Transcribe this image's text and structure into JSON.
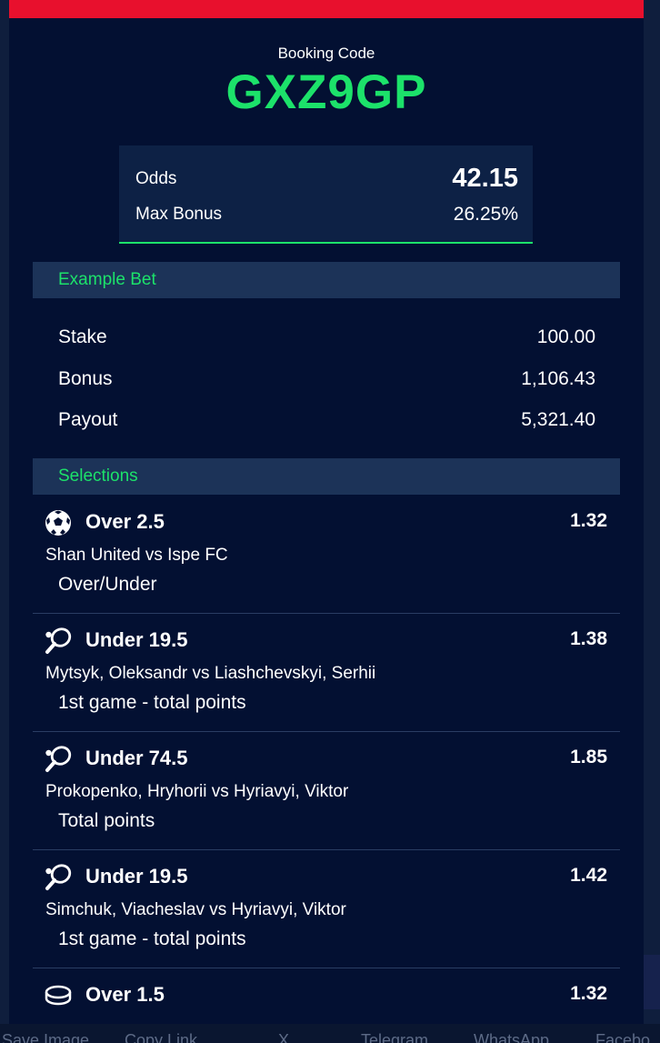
{
  "booking": {
    "label": "Booking Code",
    "code": "GXZ9GP"
  },
  "summary": {
    "odds_label": "Odds",
    "odds_value": "42.15",
    "max_bonus_label": "Max Bonus",
    "max_bonus_value": "26.25%"
  },
  "example_bet": {
    "header": "Example Bet",
    "stake_label": "Stake",
    "stake_value": "100.00",
    "bonus_label": "Bonus",
    "bonus_value": "1,106.43",
    "payout_label": "Payout",
    "payout_value": "5,321.40"
  },
  "selections": {
    "header": "Selections",
    "items": [
      {
        "icon": "soccer-ball-icon",
        "pick": "Over 2.5",
        "odds": "1.32",
        "match": "Shan United vs Ispe FC",
        "market": "Over/Under"
      },
      {
        "icon": "table-tennis-icon",
        "pick": "Under 19.5",
        "odds": "1.38",
        "match": "Mytsyk, Oleksandr vs Liashchevskyi, Serhii",
        "market": "1st game - total points"
      },
      {
        "icon": "table-tennis-icon",
        "pick": "Under 74.5",
        "odds": "1.85",
        "match": "Prokopenko, Hryhorii vs Hyriavyi, Viktor",
        "market": "Total points"
      },
      {
        "icon": "table-tennis-icon",
        "pick": "Under 19.5",
        "odds": "1.42",
        "match": "Simchuk, Viacheslav vs Hyriavyi, Viktor",
        "market": "1st game - total points"
      },
      {
        "icon": "hockey-puck-icon",
        "pick": "Over 1.5",
        "odds": "1.32",
        "match": "",
        "market": ""
      }
    ]
  },
  "share_bar": {
    "items": [
      "Save Image",
      "Copy Link",
      "X",
      "Telegram",
      "WhatsApp",
      "Facebo"
    ]
  },
  "colors": {
    "accent_green": "#1ce26a",
    "top_bar_red": "#e8102d",
    "modal_bg": "#031032",
    "section_header_bg": "#1c3358"
  }
}
